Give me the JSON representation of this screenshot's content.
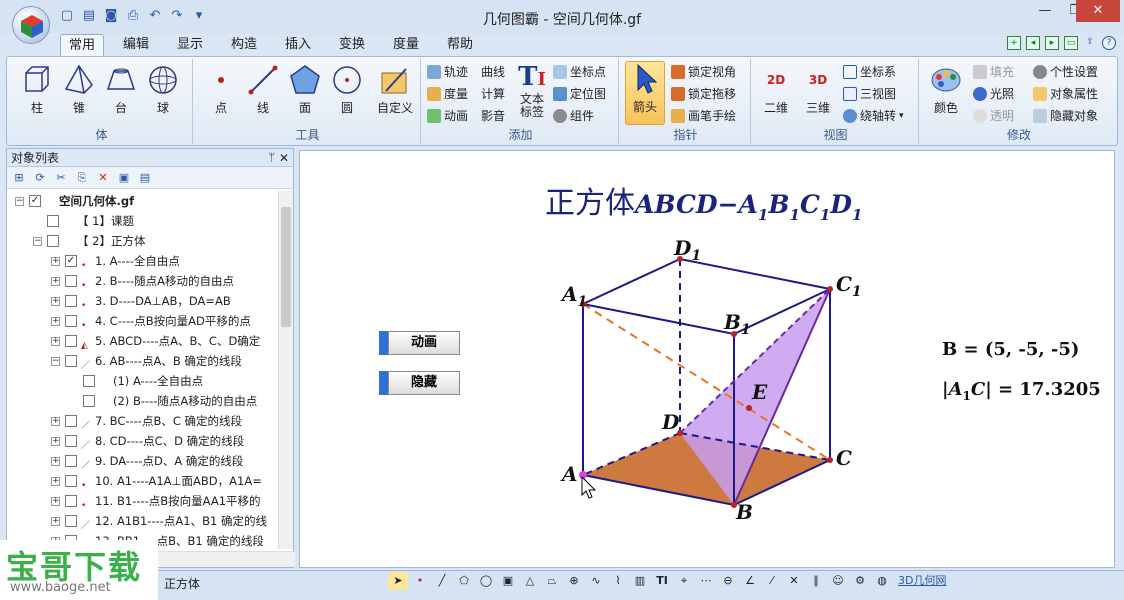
{
  "window": {
    "title": "几何图霸 - 空间几何体.gf"
  },
  "qat": [
    "new-icon",
    "open-icon",
    "save-icon",
    "print-icon",
    "undo-icon",
    "redo-icon",
    "dropdown-icon"
  ],
  "tabs": [
    {
      "label": "常用",
      "active": true
    },
    {
      "label": "编辑"
    },
    {
      "label": "显示"
    },
    {
      "label": "构造"
    },
    {
      "label": "插入"
    },
    {
      "label": "变换"
    },
    {
      "label": "度量"
    },
    {
      "label": "帮助"
    }
  ],
  "ribbon": {
    "body": {
      "label": "体",
      "items": [
        "柱",
        "锥",
        "台",
        "球"
      ]
    },
    "tools": {
      "label": "工具",
      "items": [
        "点",
        "线",
        "面",
        "圆",
        "自定义"
      ]
    },
    "add": {
      "label": "添加",
      "items": [
        "轨迹",
        "曲线",
        "度量",
        "计算",
        "动画",
        "影音",
        "文本",
        "标签",
        "坐标点",
        "定位图",
        "组件"
      ]
    },
    "pointer": {
      "label": "指针",
      "arrow": "箭头",
      "items": [
        "锁定视角",
        "锁定拖移",
        "画笔手绘"
      ]
    },
    "view": {
      "label": "视图",
      "items": [
        "二维",
        "三维",
        "坐标系",
        "三视图",
        "绕轴转"
      ]
    },
    "modify": {
      "label": "修改",
      "color": "颜色",
      "items": [
        "填充",
        "光照",
        "透明",
        "个性设置",
        "对象属性",
        "隐藏对象"
      ]
    }
  },
  "objectlist": {
    "title": "对象列表",
    "rows": [
      {
        "text": "空间几何体.gf",
        "level": 0,
        "checked": true,
        "bold": true
      },
      {
        "text": "【 1】课题",
        "level": 1
      },
      {
        "text": "【 2】正方体",
        "level": 1
      },
      {
        "text": "1. A----全自由点",
        "level": 2,
        "checked": true
      },
      {
        "text": "2. B----随点A移动的自由点",
        "level": 2
      },
      {
        "text": "3. D----DA⊥AB，DA=AB",
        "level": 2
      },
      {
        "text": "4. C----点B按向量AD平移的点",
        "level": 2
      },
      {
        "text": "5. ABCD----点A、B、C、D确定",
        "level": 2
      },
      {
        "text": "6. AB----点A、B 确定的线段",
        "level": 2
      },
      {
        "text": "(1) A----全自由点",
        "level": 3
      },
      {
        "text": "(2) B----随点A移动的自由点",
        "level": 3
      },
      {
        "text": "7. BC----点B、C 确定的线段",
        "level": 2
      },
      {
        "text": "8. CD----点C、D 确定的线段",
        "level": 2
      },
      {
        "text": "9. DA----点D、A 确定的线段",
        "level": 2
      },
      {
        "text": "10. A1----A1A⊥面ABD，A1A=",
        "level": 2
      },
      {
        "text": "11. B1----点B按向量AA1平移的",
        "level": 2
      },
      {
        "text": "12. A1B1----点A1、B1 确定的线",
        "level": 2
      },
      {
        "text": "13. BB1----点B、B1 确定的线段",
        "level": 2
      }
    ]
  },
  "canvas": {
    "title_prefix": "正方体",
    "buttons": {
      "animate": "动画",
      "hide": "隐藏"
    },
    "measure1": "B = (5, -5, -5)",
    "measure2": "|A1C| = 17.3205",
    "points": [
      "A",
      "B",
      "C",
      "D",
      "A1",
      "B1",
      "C1",
      "D1",
      "E"
    ]
  },
  "status": {
    "text": "正方体"
  },
  "bottom_toolbar": [
    "arrow",
    "point",
    "line",
    "polygon",
    "circle",
    "cube",
    "cone",
    "frustum",
    "sphere",
    "traj",
    "curve",
    "measure",
    "text",
    "coord",
    "more"
  ],
  "bottom_link": "3D几何网",
  "watermark": {
    "main": "宝哥下载",
    "url": "www.baoge.net"
  },
  "colors": {
    "accent": "#2f6fd6",
    "face": "#c79ef0",
    "base": "#c96a2a",
    "edge": "#1a1a8a"
  }
}
